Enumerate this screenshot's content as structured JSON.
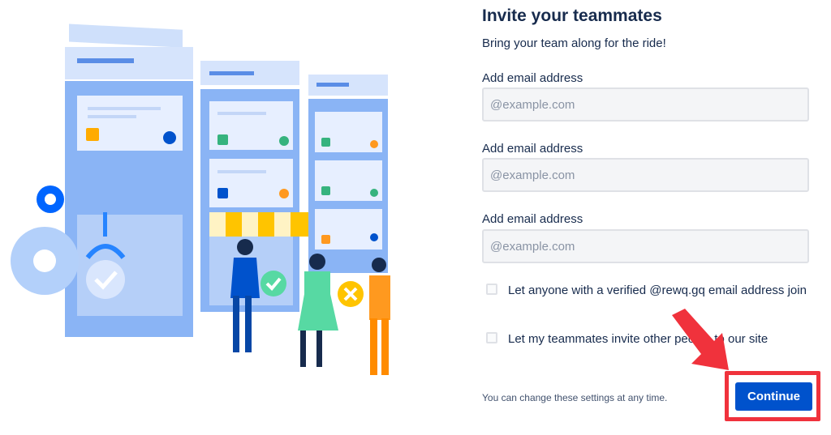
{
  "form": {
    "title": "Invite your teammates",
    "subtitle": "Bring your team along for the ride!",
    "email_fields": [
      {
        "label": "Add email address",
        "placeholder": "@example.com",
        "value": ""
      },
      {
        "label": "Add email address",
        "placeholder": "@example.com",
        "value": ""
      },
      {
        "label": "Add email address",
        "placeholder": "@example.com",
        "value": ""
      }
    ],
    "options": [
      {
        "label": "Let anyone with a verified @rewq.gq email address join",
        "checked": false
      },
      {
        "label": "Let my teammates invite other people to our site",
        "checked": false
      }
    ],
    "footnote": "You can change these settings at any time.",
    "continue_label": "Continue"
  },
  "annotation": {
    "highlight_color": "#f0323c",
    "arrow_icon": "arrow-pointer-icon"
  },
  "colors": {
    "primary_button": "#0052cc",
    "text": "#172b4d",
    "input_bg": "#f4f5f7",
    "input_border": "#dfe1e6"
  }
}
